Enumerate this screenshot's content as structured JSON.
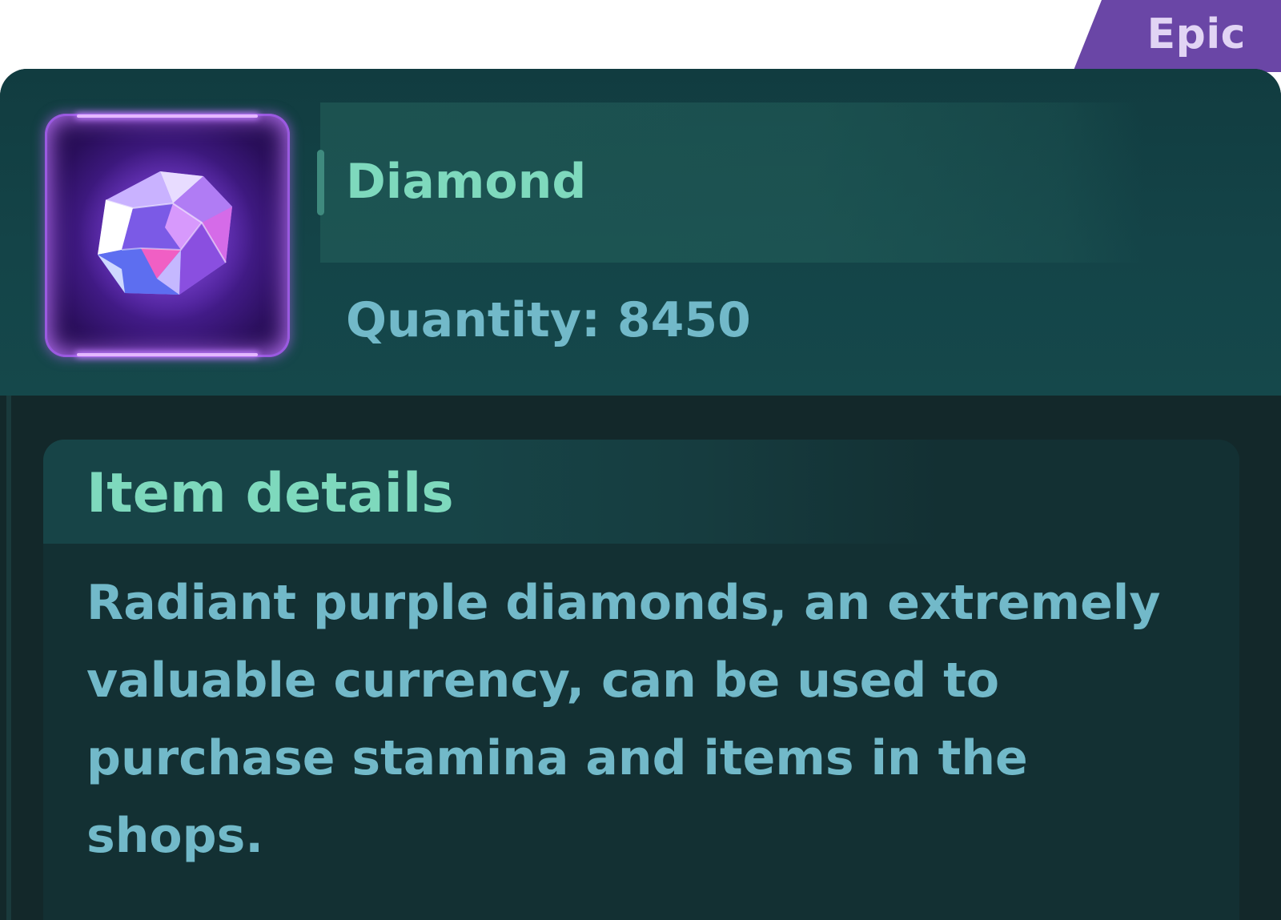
{
  "rarity": {
    "label": "Epic",
    "color": "#6a46a6"
  },
  "item": {
    "icon": "purple-diamond-gem-icon",
    "name": "Diamond",
    "quantity_text": "Quantity: 8450",
    "quantity": 8450
  },
  "details": {
    "title": "Item details",
    "description": "Radiant purple diamonds, an extremely\nvaluable currency, can be used to\npurchase stamina and items in the\nshops."
  },
  "colors": {
    "card_background": "#13282a",
    "header_background": "#144448",
    "title_text": "#7ed9bd",
    "body_text": "#72b9c9",
    "epic_purple": "#6a46a6"
  }
}
